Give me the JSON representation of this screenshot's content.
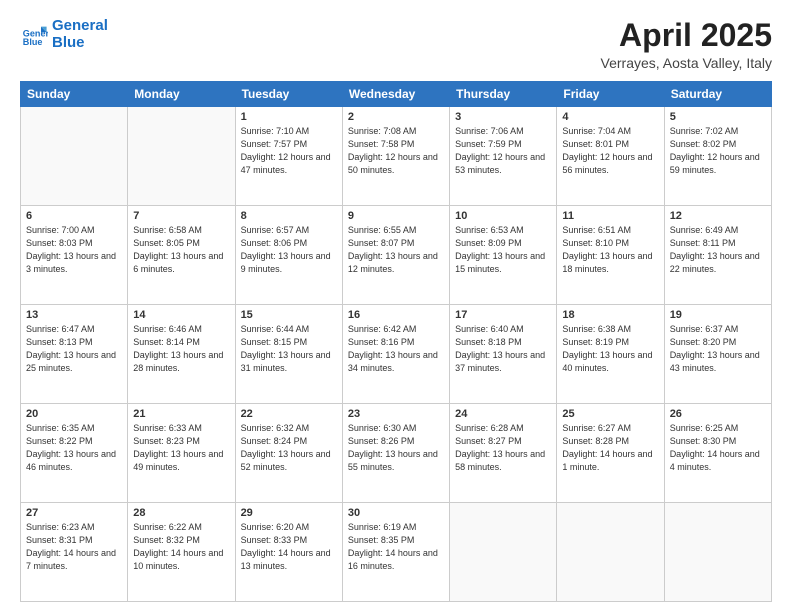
{
  "logo": {
    "line1": "General",
    "line2": "Blue"
  },
  "title": "April 2025",
  "subtitle": "Verrayes, Aosta Valley, Italy",
  "days_of_week": [
    "Sunday",
    "Monday",
    "Tuesday",
    "Wednesday",
    "Thursday",
    "Friday",
    "Saturday"
  ],
  "weeks": [
    [
      {
        "day": "",
        "info": ""
      },
      {
        "day": "",
        "info": ""
      },
      {
        "day": "1",
        "info": "Sunrise: 7:10 AM\nSunset: 7:57 PM\nDaylight: 12 hours and 47 minutes."
      },
      {
        "day": "2",
        "info": "Sunrise: 7:08 AM\nSunset: 7:58 PM\nDaylight: 12 hours and 50 minutes."
      },
      {
        "day": "3",
        "info": "Sunrise: 7:06 AM\nSunset: 7:59 PM\nDaylight: 12 hours and 53 minutes."
      },
      {
        "day": "4",
        "info": "Sunrise: 7:04 AM\nSunset: 8:01 PM\nDaylight: 12 hours and 56 minutes."
      },
      {
        "day": "5",
        "info": "Sunrise: 7:02 AM\nSunset: 8:02 PM\nDaylight: 12 hours and 59 minutes."
      }
    ],
    [
      {
        "day": "6",
        "info": "Sunrise: 7:00 AM\nSunset: 8:03 PM\nDaylight: 13 hours and 3 minutes."
      },
      {
        "day": "7",
        "info": "Sunrise: 6:58 AM\nSunset: 8:05 PM\nDaylight: 13 hours and 6 minutes."
      },
      {
        "day": "8",
        "info": "Sunrise: 6:57 AM\nSunset: 8:06 PM\nDaylight: 13 hours and 9 minutes."
      },
      {
        "day": "9",
        "info": "Sunrise: 6:55 AM\nSunset: 8:07 PM\nDaylight: 13 hours and 12 minutes."
      },
      {
        "day": "10",
        "info": "Sunrise: 6:53 AM\nSunset: 8:09 PM\nDaylight: 13 hours and 15 minutes."
      },
      {
        "day": "11",
        "info": "Sunrise: 6:51 AM\nSunset: 8:10 PM\nDaylight: 13 hours and 18 minutes."
      },
      {
        "day": "12",
        "info": "Sunrise: 6:49 AM\nSunset: 8:11 PM\nDaylight: 13 hours and 22 minutes."
      }
    ],
    [
      {
        "day": "13",
        "info": "Sunrise: 6:47 AM\nSunset: 8:13 PM\nDaylight: 13 hours and 25 minutes."
      },
      {
        "day": "14",
        "info": "Sunrise: 6:46 AM\nSunset: 8:14 PM\nDaylight: 13 hours and 28 minutes."
      },
      {
        "day": "15",
        "info": "Sunrise: 6:44 AM\nSunset: 8:15 PM\nDaylight: 13 hours and 31 minutes."
      },
      {
        "day": "16",
        "info": "Sunrise: 6:42 AM\nSunset: 8:16 PM\nDaylight: 13 hours and 34 minutes."
      },
      {
        "day": "17",
        "info": "Sunrise: 6:40 AM\nSunset: 8:18 PM\nDaylight: 13 hours and 37 minutes."
      },
      {
        "day": "18",
        "info": "Sunrise: 6:38 AM\nSunset: 8:19 PM\nDaylight: 13 hours and 40 minutes."
      },
      {
        "day": "19",
        "info": "Sunrise: 6:37 AM\nSunset: 8:20 PM\nDaylight: 13 hours and 43 minutes."
      }
    ],
    [
      {
        "day": "20",
        "info": "Sunrise: 6:35 AM\nSunset: 8:22 PM\nDaylight: 13 hours and 46 minutes."
      },
      {
        "day": "21",
        "info": "Sunrise: 6:33 AM\nSunset: 8:23 PM\nDaylight: 13 hours and 49 minutes."
      },
      {
        "day": "22",
        "info": "Sunrise: 6:32 AM\nSunset: 8:24 PM\nDaylight: 13 hours and 52 minutes."
      },
      {
        "day": "23",
        "info": "Sunrise: 6:30 AM\nSunset: 8:26 PM\nDaylight: 13 hours and 55 minutes."
      },
      {
        "day": "24",
        "info": "Sunrise: 6:28 AM\nSunset: 8:27 PM\nDaylight: 13 hours and 58 minutes."
      },
      {
        "day": "25",
        "info": "Sunrise: 6:27 AM\nSunset: 8:28 PM\nDaylight: 14 hours and 1 minute."
      },
      {
        "day": "26",
        "info": "Sunrise: 6:25 AM\nSunset: 8:30 PM\nDaylight: 14 hours and 4 minutes."
      }
    ],
    [
      {
        "day": "27",
        "info": "Sunrise: 6:23 AM\nSunset: 8:31 PM\nDaylight: 14 hours and 7 minutes."
      },
      {
        "day": "28",
        "info": "Sunrise: 6:22 AM\nSunset: 8:32 PM\nDaylight: 14 hours and 10 minutes."
      },
      {
        "day": "29",
        "info": "Sunrise: 6:20 AM\nSunset: 8:33 PM\nDaylight: 14 hours and 13 minutes."
      },
      {
        "day": "30",
        "info": "Sunrise: 6:19 AM\nSunset: 8:35 PM\nDaylight: 14 hours and 16 minutes."
      },
      {
        "day": "",
        "info": ""
      },
      {
        "day": "",
        "info": ""
      },
      {
        "day": "",
        "info": ""
      }
    ]
  ]
}
